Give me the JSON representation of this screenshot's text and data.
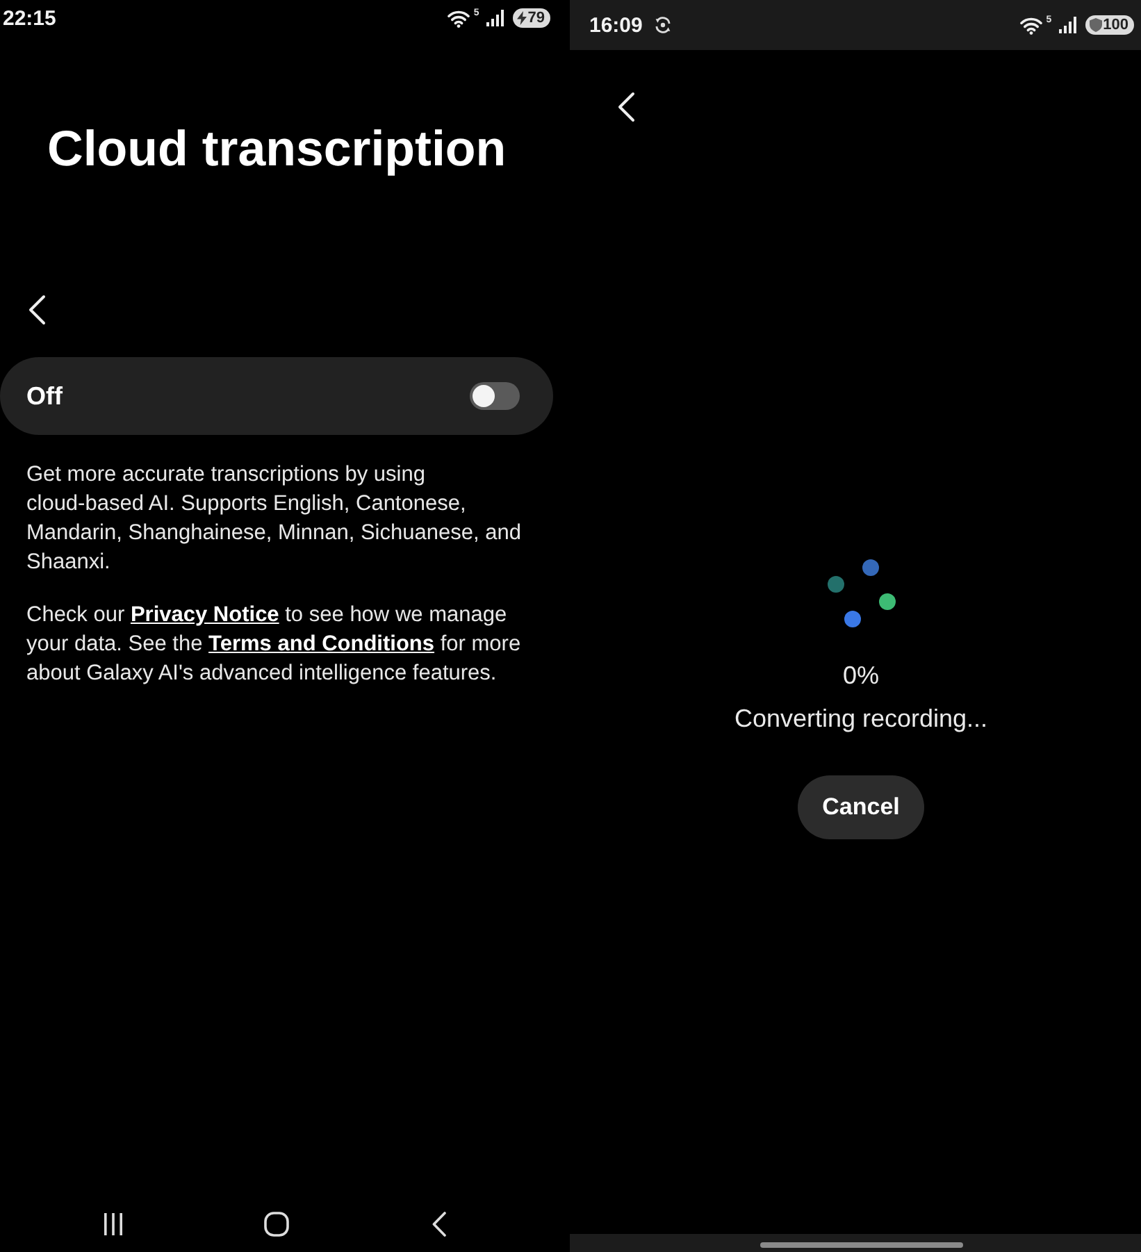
{
  "left_screen": {
    "status_bar": {
      "time": "22:15",
      "wifi_badge": "5",
      "battery": "79"
    },
    "title": "Cloud transcription",
    "toggle": {
      "label": "Off",
      "on": false
    },
    "paragraphs": [
      [
        {
          "kind": "text",
          "text": "Get more accurate transcriptions by using cloud-based AI. Supports English, Cantonese, Mandarin, Shanghainese, Minnan, Sichuanese, and Shaanxi."
        }
      ],
      [
        {
          "kind": "text",
          "text": "Check our "
        },
        {
          "kind": "link",
          "text": "Privacy Notice"
        },
        {
          "kind": "text",
          "text": " to see how we manage your data. See the "
        },
        {
          "kind": "link",
          "text": "Terms and Conditions"
        },
        {
          "kind": "text",
          "text": " for more about Galaxy AI's advanced intelligence features."
        }
      ]
    ]
  },
  "right_screen": {
    "status_bar": {
      "time": "16:09",
      "wifi_badge": "5",
      "battery": "100"
    },
    "progress": "0%",
    "message": "Converting recording...",
    "cancel_button": "Cancel"
  }
}
